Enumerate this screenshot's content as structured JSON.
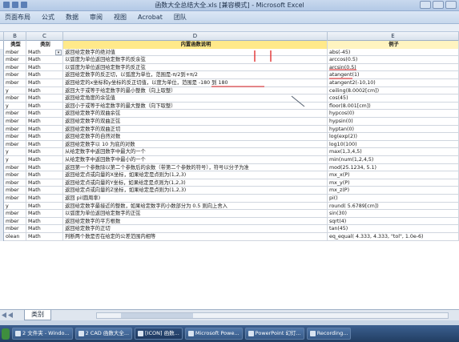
{
  "window": {
    "title": "函数大全总结大全.xls [兼容模式] - Microsoft Excel"
  },
  "ribbon": {
    "tabs": [
      "页面布局",
      "公式",
      "数据",
      "审阅",
      "视图",
      "Acrobat",
      "团队"
    ]
  },
  "columns": [
    "B",
    "C",
    "D",
    "E"
  ],
  "table": {
    "headers": [
      "类型",
      "类别",
      "内置函数说明",
      "例子"
    ],
    "rows": [
      [
        "mber",
        "Math",
        "返回给定数字的绝对值",
        "abs(-45)"
      ],
      [
        "mber",
        "Math",
        "以弧度为单位返回给定数字的反余弦",
        "arccos(0.5)"
      ],
      [
        "mber",
        "Math",
        "以弧度为单位返回给定数字的反正弦",
        "arcsin(0.5)"
      ],
      [
        "mber",
        "Math",
        "返回给定数字的反正切，以弧度为单位，范围是-π/2到+π/2",
        "atangent(1)"
      ],
      [
        "mber",
        "Math",
        "返回给定的x坐标和y坐标的反正切值，以度为单位，范围是 -180 到 180",
        "atangent2(-10,10)"
      ],
      [
        "y",
        "Math",
        "返回大于或等于给定数字的最小整数（向上取整）",
        "ceiling(8.0002[cm])"
      ],
      [
        "mber",
        "Math",
        "返回给定角度的余弦值",
        "cos(45)"
      ],
      [
        "y",
        "Math",
        "返回小于或等于给定数字的最大整数（向下取整）",
        "floor(8.001[cm])"
      ],
      [
        "mber",
        "Math",
        "返回给定数字的双曲余弦",
        "hypcos(0)"
      ],
      [
        "mber",
        "Math",
        "返回给定数字的双曲正弦",
        "hypsin(0)"
      ],
      [
        "mber",
        "Math",
        "返回给定数字的双曲正切",
        "hyptan(0)"
      ],
      [
        "mber",
        "Math",
        "返回给定数字的自然对数",
        "log(exp(2))"
      ],
      [
        "mber",
        "Math",
        "返回给定数字以 10 为底的对数",
        "log10(100)"
      ],
      [
        "y",
        "Math",
        "从给定数字中返回数字中最大的一个",
        "max(1,3,4,5)"
      ],
      [
        "y",
        "Math",
        "从给定数字中返回数字中最小的一个",
        "min(num(1,2,4,5)"
      ],
      [
        "mber",
        "Math",
        "返回第一个参数除以第二个参数后的余数（带第二个参数的符号），符号以分子为准",
        "mod(25.1234, 5.1)"
      ],
      [
        "mber",
        "Math",
        "返回给定点或向量的X坐标，如果给定是点则为(1,2,3)",
        "mx_x(P)"
      ],
      [
        "mber",
        "Math",
        "返回给定点或向量的Y坐标，如果给定是点则为(1,2,3)",
        "mx_y(P)"
      ],
      [
        "mber",
        "Math",
        "返回给定点或向量的Z坐标，如果给定是点则为(1,2,3)",
        "mx_z(P)"
      ],
      [
        "mber",
        "Math",
        "返回 pi(圆周率)",
        "pi()"
      ],
      [
        "y",
        "Math",
        "返回给定数字最接近的整数，如果给定数字的小数部分为 0.5 则向上舍入",
        "round( 5.6789[cm])"
      ],
      [
        "mber",
        "Math",
        "以弧度为单位返回给定数字的正弦",
        "sin(30)"
      ],
      [
        "mber",
        "Math",
        "返回给定数字的平方根数",
        "sqrt(4)"
      ],
      [
        "mber",
        "Math",
        "返回给定数字的正切",
        "tan(45)"
      ],
      [
        "olean",
        "Math",
        "判断两个数是否在给定的公差范围内相等",
        "eq_equal( 4.333, 4.333, \"tol\", 1.0e-6)"
      ]
    ]
  },
  "sheet_tab": "类别",
  "taskbar": {
    "items": [
      "2 文件夹 - Windo...",
      "2 CAD 函数大全...",
      "[ICON] 函数...",
      "Microsoft Powe...",
      "PowerPoint 幻灯...",
      "Recording..."
    ]
  },
  "colors": {
    "header_desc_bg": "#ffe98a",
    "annotation": "#e02020"
  }
}
